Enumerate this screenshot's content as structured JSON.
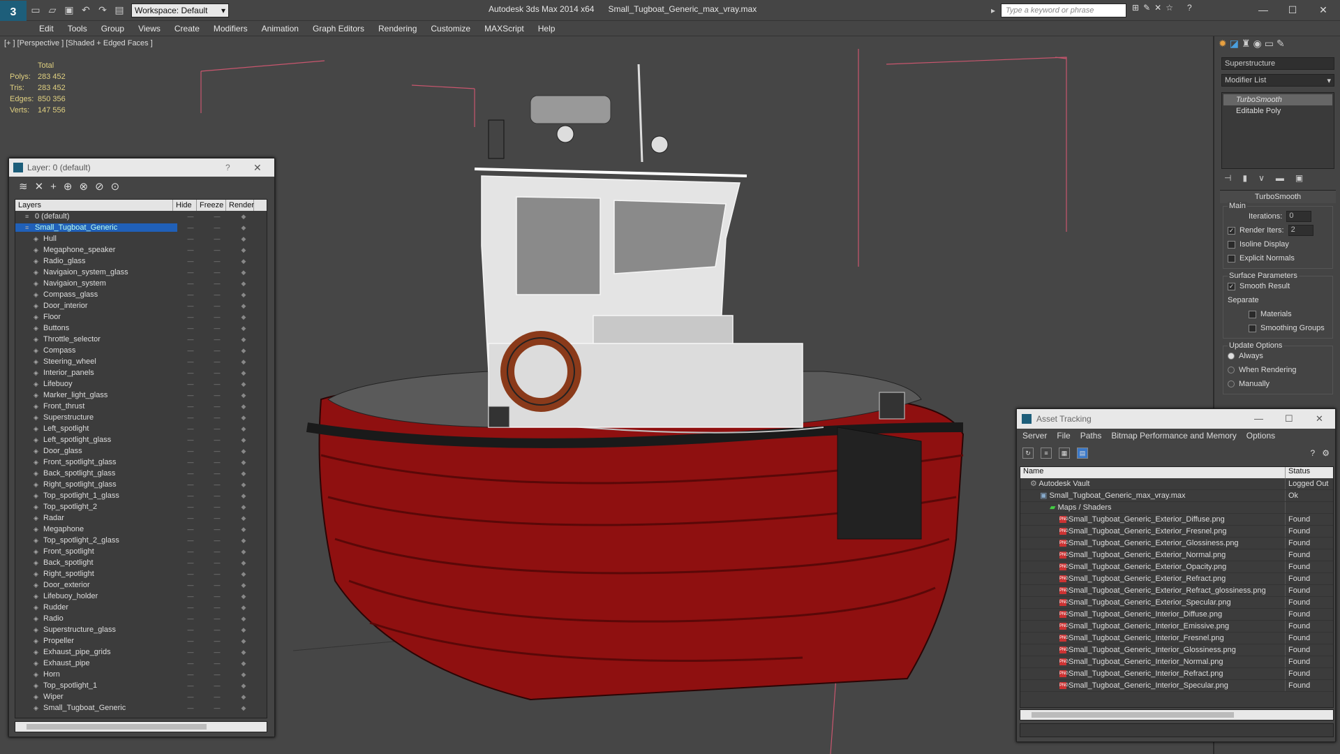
{
  "window": {
    "app_title": "Autodesk 3ds Max 2014 x64",
    "file_title": "Small_Tugboat_Generic_max_vray.max",
    "workspace": "Workspace: Default",
    "search_placeholder": "Type a keyword or phrase"
  },
  "menu": [
    "Edit",
    "Tools",
    "Group",
    "Views",
    "Create",
    "Modifiers",
    "Animation",
    "Graph Editors",
    "Rendering",
    "Customize",
    "MAXScript",
    "Help"
  ],
  "viewport": {
    "label": "[+ ] [Perspective ] [Shaded + Edged Faces ]",
    "stats_header": "Total",
    "stats": [
      {
        "label": "Polys:",
        "value": "283 452"
      },
      {
        "label": "Tris:",
        "value": "283 452"
      },
      {
        "label": "Edges:",
        "value": "850 356"
      },
      {
        "label": "Verts:",
        "value": "147 556"
      }
    ]
  },
  "layer_panel": {
    "title": "Layer: 0 (default)",
    "help": "?",
    "columns": [
      "Layers",
      "Hide",
      "Freeze",
      "Render"
    ],
    "rows": [
      {
        "name": "0 (default)",
        "level": 1,
        "selected": false
      },
      {
        "name": "Small_Tugboat_Generic",
        "level": 1,
        "selected": true
      },
      {
        "name": "Hull",
        "level": 2
      },
      {
        "name": "Megaphone_speaker",
        "level": 2
      },
      {
        "name": "Radio_glass",
        "level": 2
      },
      {
        "name": "Navigaion_system_glass",
        "level": 2
      },
      {
        "name": "Navigaion_system",
        "level": 2
      },
      {
        "name": "Compass_glass",
        "level": 2
      },
      {
        "name": "Door_interior",
        "level": 2
      },
      {
        "name": "Floor",
        "level": 2
      },
      {
        "name": "Buttons",
        "level": 2
      },
      {
        "name": "Throttle_selector",
        "level": 2
      },
      {
        "name": "Compass",
        "level": 2
      },
      {
        "name": "Steering_wheel",
        "level": 2
      },
      {
        "name": "Interior_panels",
        "level": 2
      },
      {
        "name": "Lifebuoy",
        "level": 2
      },
      {
        "name": "Marker_light_glass",
        "level": 2
      },
      {
        "name": "Front_thrust",
        "level": 2
      },
      {
        "name": "Superstructure",
        "level": 2
      },
      {
        "name": "Left_spotlight",
        "level": 2
      },
      {
        "name": "Left_spotlight_glass",
        "level": 2
      },
      {
        "name": "Door_glass",
        "level": 2
      },
      {
        "name": "Front_spotlight_glass",
        "level": 2
      },
      {
        "name": "Back_spotlight_glass",
        "level": 2
      },
      {
        "name": "Right_spotlight_glass",
        "level": 2
      },
      {
        "name": "Top_spotlight_1_glass",
        "level": 2
      },
      {
        "name": "Top_spotlight_2",
        "level": 2
      },
      {
        "name": "Radar",
        "level": 2
      },
      {
        "name": "Megaphone",
        "level": 2
      },
      {
        "name": "Top_spotlight_2_glass",
        "level": 2
      },
      {
        "name": "Front_spotlight",
        "level": 2
      },
      {
        "name": "Back_spotlight",
        "level": 2
      },
      {
        "name": "Right_spotlight",
        "level": 2
      },
      {
        "name": "Door_exterior",
        "level": 2
      },
      {
        "name": "Lifebuoy_holder",
        "level": 2
      },
      {
        "name": "Rudder",
        "level": 2
      },
      {
        "name": "Radio",
        "level": 2
      },
      {
        "name": "Superstructure_glass",
        "level": 2
      },
      {
        "name": "Propeller",
        "level": 2
      },
      {
        "name": "Exhaust_pipe_grids",
        "level": 2
      },
      {
        "name": "Exhaust_pipe",
        "level": 2
      },
      {
        "name": "Horn",
        "level": 2
      },
      {
        "name": "Top_spotlight_1",
        "level": 2
      },
      {
        "name": "Wiper",
        "level": 2
      },
      {
        "name": "Small_Tugboat_Generic",
        "level": 2
      }
    ]
  },
  "command_panel": {
    "object_name": "Superstructure",
    "modifier_list": "Modifier List",
    "stack": [
      "TurboSmooth",
      "Editable Poly"
    ],
    "rollout_title": "TurboSmooth",
    "main_group": "Main",
    "iterations_label": "Iterations:",
    "iterations_value": "0",
    "render_iters_label": "Render Iters:",
    "render_iters_value": "2",
    "isoline": "Isoline Display",
    "explicit_normals": "Explicit Normals",
    "surface_group": "Surface Parameters",
    "smooth_result": "Smooth Result",
    "separate": "Separate",
    "materials": "Materials",
    "smoothing_groups": "Smoothing Groups",
    "update_group": "Update Options",
    "always": "Always",
    "when_rendering": "When Rendering",
    "manually": "Manually"
  },
  "asset_tracking": {
    "title": "Asset Tracking",
    "menu": [
      "Server",
      "File",
      "Paths",
      "Bitmap Performance and Memory",
      "Options"
    ],
    "columns": [
      "Name",
      "Status"
    ],
    "rows": [
      {
        "name": "Autodesk Vault",
        "status": "Logged Out",
        "indent": 1,
        "type": "vault"
      },
      {
        "name": "Small_Tugboat_Generic_max_vray.max",
        "status": "Ok",
        "indent": 2,
        "type": "max"
      },
      {
        "name": "Maps / Shaders",
        "status": "",
        "indent": 3,
        "type": "folder"
      },
      {
        "name": "Small_Tugboat_Generic_Exterior_Diffuse.png",
        "status": "Found",
        "indent": 4,
        "type": "png"
      },
      {
        "name": "Small_Tugboat_Generic_Exterior_Fresnel.png",
        "status": "Found",
        "indent": 4,
        "type": "png"
      },
      {
        "name": "Small_Tugboat_Generic_Exterior_Glossiness.png",
        "status": "Found",
        "indent": 4,
        "type": "png"
      },
      {
        "name": "Small_Tugboat_Generic_Exterior_Normal.png",
        "status": "Found",
        "indent": 4,
        "type": "png"
      },
      {
        "name": "Small_Tugboat_Generic_Exterior_Opacity.png",
        "status": "Found",
        "indent": 4,
        "type": "png"
      },
      {
        "name": "Small_Tugboat_Generic_Exterior_Refract.png",
        "status": "Found",
        "indent": 4,
        "type": "png"
      },
      {
        "name": "Small_Tugboat_Generic_Exterior_Refract_glossiness.png",
        "status": "Found",
        "indent": 4,
        "type": "png"
      },
      {
        "name": "Small_Tugboat_Generic_Exterior_Specular.png",
        "status": "Found",
        "indent": 4,
        "type": "png"
      },
      {
        "name": "Small_Tugboat_Generic_Interior_Diffuse.png",
        "status": "Found",
        "indent": 4,
        "type": "png"
      },
      {
        "name": "Small_Tugboat_Generic_Interior_Emissive.png",
        "status": "Found",
        "indent": 4,
        "type": "png"
      },
      {
        "name": "Small_Tugboat_Generic_Interior_Fresnel.png",
        "status": "Found",
        "indent": 4,
        "type": "png"
      },
      {
        "name": "Small_Tugboat_Generic_Interior_Glossiness.png",
        "status": "Found",
        "indent": 4,
        "type": "png"
      },
      {
        "name": "Small_Tugboat_Generic_Interior_Normal.png",
        "status": "Found",
        "indent": 4,
        "type": "png"
      },
      {
        "name": "Small_Tugboat_Generic_Interior_Refract.png",
        "status": "Found",
        "indent": 4,
        "type": "png"
      },
      {
        "name": "Small_Tugboat_Generic_Interior_Specular.png",
        "status": "Found",
        "indent": 4,
        "type": "png"
      }
    ]
  },
  "colors": {
    "hull_red": "#a01010",
    "wire_white": "#f0f0f0",
    "selection_blue": "#2060b8",
    "stats_yellow": "#e0d080"
  }
}
